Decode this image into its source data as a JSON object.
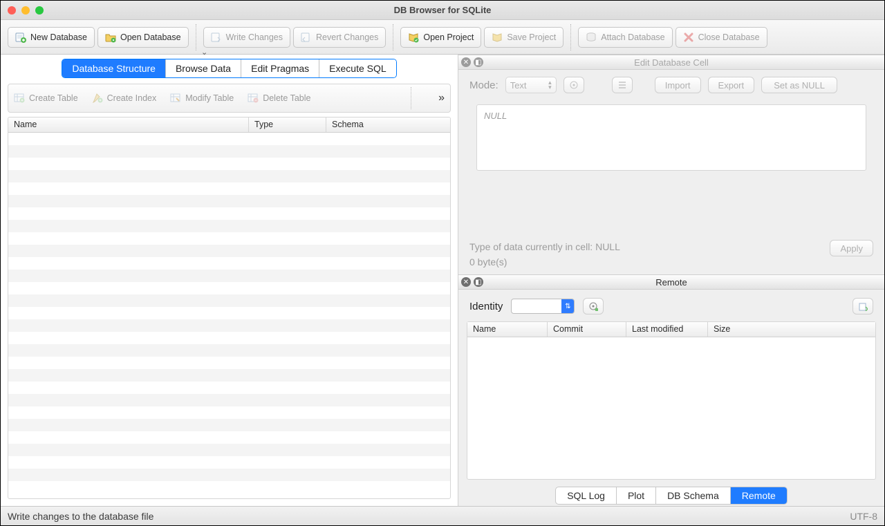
{
  "window": {
    "title": "DB Browser for SQLite"
  },
  "toolbar": {
    "new_db": "New Database",
    "open_db": "Open Database",
    "write_changes": "Write Changes",
    "revert_changes": "Revert Changes",
    "open_project": "Open Project",
    "save_project": "Save Project",
    "attach_db": "Attach Database",
    "close_db": "Close Database"
  },
  "main_tabs": {
    "structure": "Database Structure",
    "browse": "Browse Data",
    "pragmas": "Edit Pragmas",
    "execute": "Execute SQL",
    "active": "structure"
  },
  "struct_toolbar": {
    "create_table": "Create Table",
    "create_index": "Create Index",
    "modify_table": "Modify Table",
    "delete_table": "Delete Table"
  },
  "structure_columns": {
    "name": "Name",
    "type": "Type",
    "schema": "Schema"
  },
  "cell_panel": {
    "title": "Edit Database Cell",
    "mode_label": "Mode:",
    "mode_value": "Text",
    "import": "Import",
    "export": "Export",
    "set_null": "Set as NULL",
    "null_text": "NULL",
    "type_info": "Type of data currently in cell: NULL",
    "size_info": "0 byte(s)",
    "apply": "Apply"
  },
  "remote_panel": {
    "title": "Remote",
    "identity_label": "Identity",
    "columns": {
      "name": "Name",
      "commit": "Commit",
      "last_modified": "Last modified",
      "size": "Size"
    }
  },
  "bottom_tabs": {
    "sql_log": "SQL Log",
    "plot": "Plot",
    "db_schema": "DB Schema",
    "remote": "Remote",
    "active": "remote"
  },
  "status": {
    "message": "Write changes to the database file",
    "encoding": "UTF-8"
  }
}
